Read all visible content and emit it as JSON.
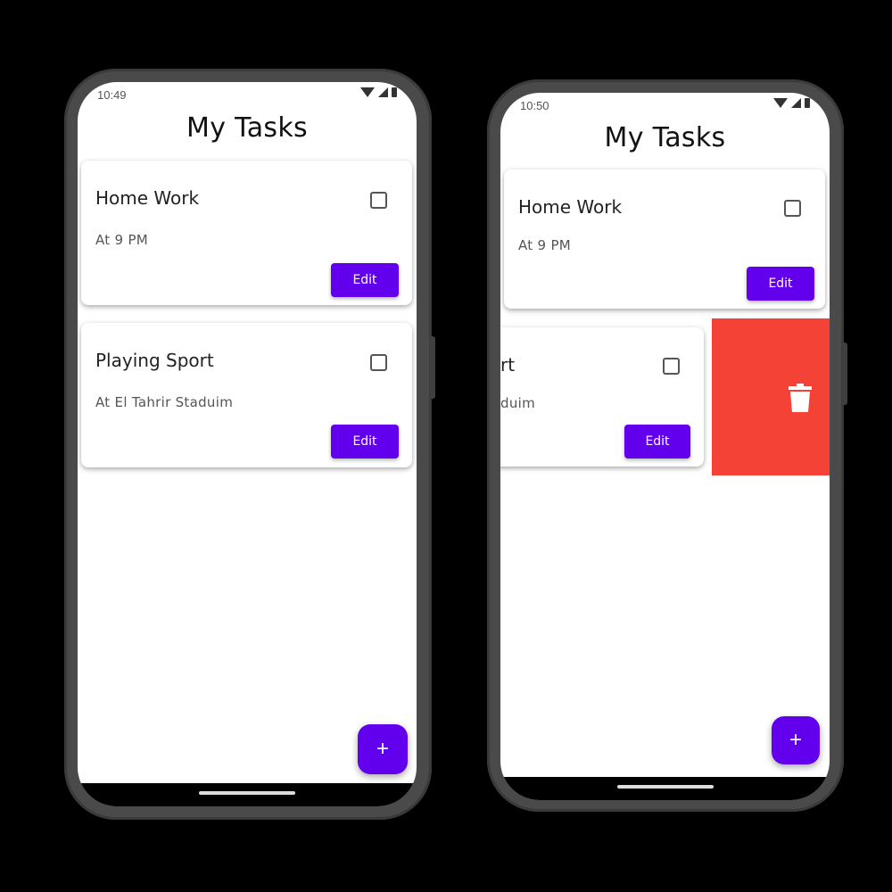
{
  "left_phone": {
    "status": {
      "time": "10:49"
    },
    "title": "My Tasks",
    "tasks": [
      {
        "title": "Home Work",
        "subtitle": "At 9 PM",
        "edit_label": "Edit"
      },
      {
        "title": "Playing Sport",
        "subtitle": "At El Tahrir Staduim",
        "edit_label": "Edit"
      }
    ],
    "fab_label": "+"
  },
  "right_phone": {
    "status": {
      "time": "10:50"
    },
    "title": "My Tasks",
    "tasks": [
      {
        "title": "Home Work",
        "subtitle": "At 9 PM",
        "edit_label": "Edit"
      },
      {
        "title": "rt",
        "subtitle": "duim",
        "edit_label": "Edit"
      }
    ],
    "swipe_action_icon": "trash-icon",
    "fab_label": "+"
  },
  "colors": {
    "accent": "#6200ee",
    "delete_background": "#f44336",
    "device_frame": "#4a4a4a"
  },
  "icons": [
    "wifi-icon",
    "signal-icon",
    "battery-icon",
    "checkbox-icon",
    "trash-icon",
    "add-icon"
  ]
}
